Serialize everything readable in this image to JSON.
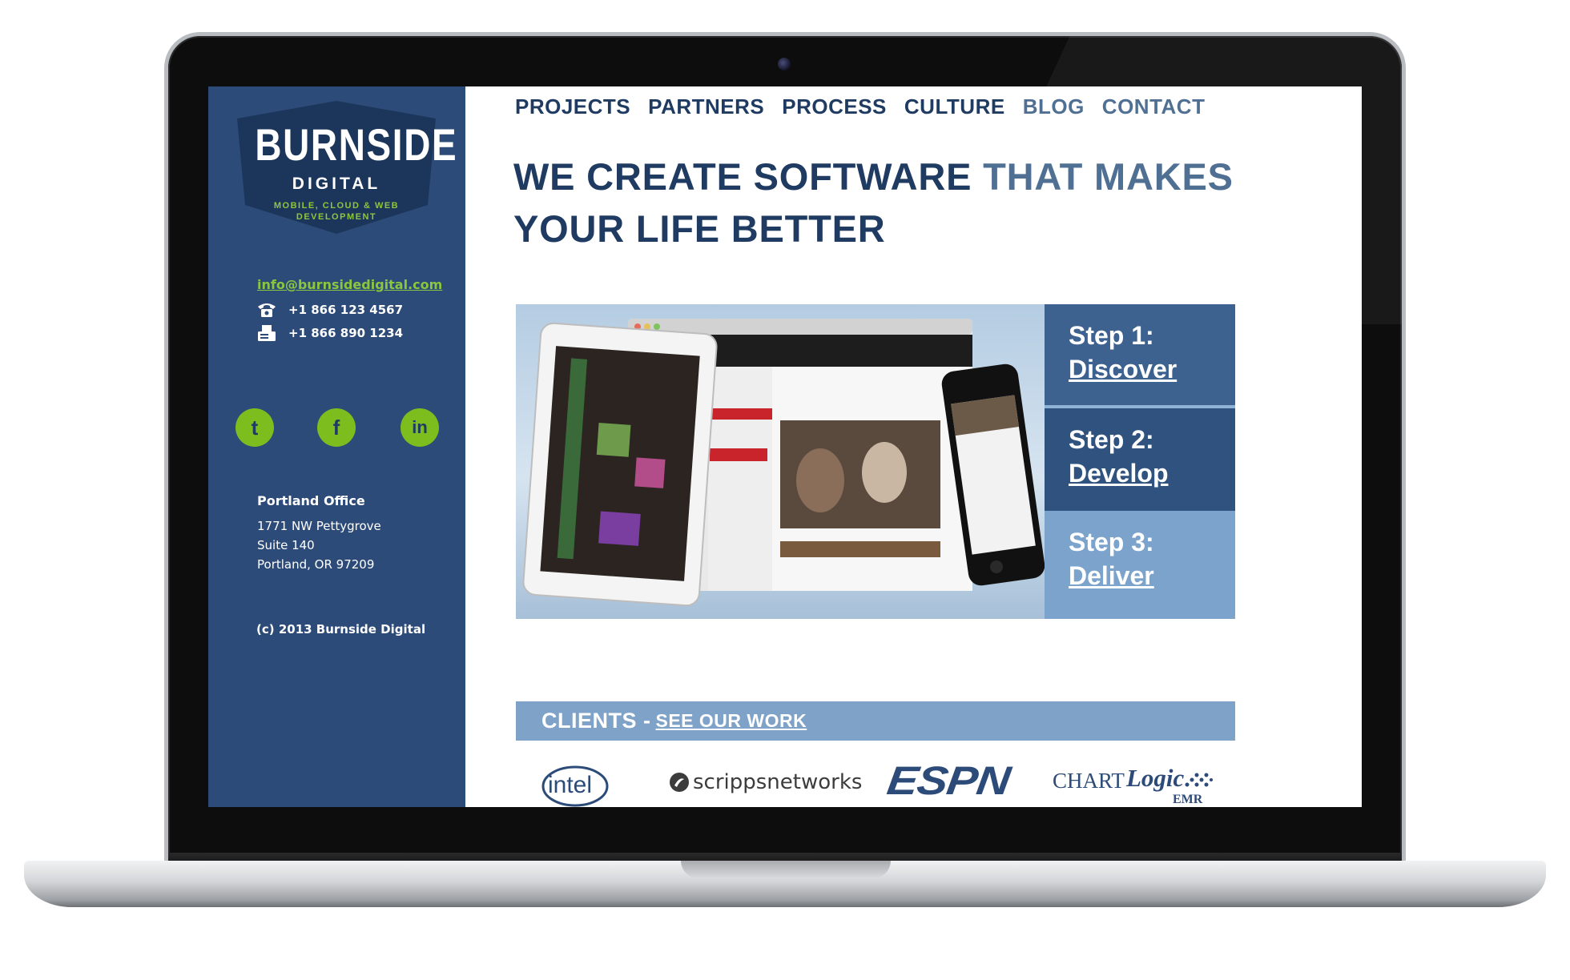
{
  "sidebar": {
    "logo": {
      "title": "BURNSIDE",
      "subtitle": "DIGITAL",
      "tagline_1": "MOBILE, CLOUD & WEB",
      "tagline_2": "DEVELOPMENT"
    },
    "email": "info@burnsidedigital.com",
    "phone": "+1 866 123 4567",
    "fax": "+1 866 890 1234",
    "social": {
      "twitter": "t",
      "facebook": "f",
      "linkedin": "in"
    },
    "office": {
      "title": "Portland Office",
      "line1": "1771 NW Pettygrove",
      "line2": "Suite 140",
      "line3": "Portland, OR 97209"
    },
    "copyright": "(c) 2013 Burnside Digital"
  },
  "nav": {
    "items": [
      "PROJECTS",
      "PARTNERS",
      "PROCESS",
      "CULTURE",
      "BLOG",
      "CONTACT"
    ]
  },
  "headline": {
    "part1": "WE CREATE SOFTWARE ",
    "part2": "THAT MAKES",
    "part3": "YOUR LIFE BETTER"
  },
  "steps": [
    {
      "label": "Step 1:",
      "link": "Discover",
      "color": "#3d6290"
    },
    {
      "label": "Step 2:",
      "link": "Develop",
      "color": "#2f527f"
    },
    {
      "label": "Step 3:",
      "link": "Deliver",
      "color": "#7ba3cb"
    }
  ],
  "clients": {
    "heading": "CLIENTS -",
    "link": "SEE OUR WORK",
    "logos": {
      "intel": "intel",
      "scripps": "scrippsnetworks",
      "espn": "ESPN",
      "chart_a": "CHART",
      "chart_b": "Logic",
      "chart_c": "EMR"
    }
  },
  "colors": {
    "sidebar": "#2c4b78",
    "accent_green": "#8cc63f",
    "navy": "#1f3b61",
    "steel": "#4f6f93"
  }
}
